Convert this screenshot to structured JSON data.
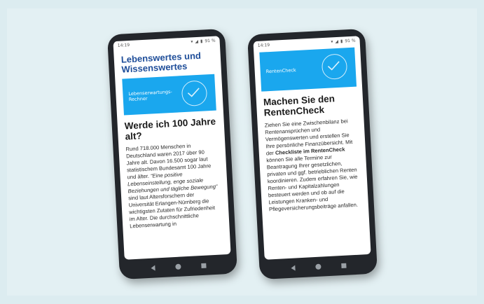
{
  "phone_left": {
    "status": {
      "time": "14:19",
      "battery": "91 %"
    },
    "section_heading": "Lebenswertes und Wissenswertes",
    "banner_label": "Lebenserwartungs-Rechner",
    "title": "Werde ich 100 Jahre alt?",
    "body_1": "Rund 718.000 Menschen in Deutschland waren 2017 über 90 Jahre alt. Davon 16.500 sogar laut statistischem Bundesamt 100 Jahre und älter.",
    "body_quote": "“Eine positive Lebenseinstellung, enge soziale Beziehungen und tägliche Bewegung”",
    "body_2": "sind laut Altersforschern der Universität Erlangen-Nürnberg die wichtigsten Zutaten für Zufriedenheit im Alter. Die durchschnittliche Lebenserwartung in"
  },
  "phone_right": {
    "status": {
      "time": "14:19",
      "battery": "91 %"
    },
    "banner_label": "RentenCheck",
    "title": "Machen Sie den RentenCheck",
    "body_1": "Ziehen Sie eine Zwischenbilanz bei Rentenansprüchen und Vermögenswerten und erstellen Sie Ihre persönliche Finanzübersicht. Mit der",
    "body_bold": "Checkliste im RentenCheck",
    "body_2": "können Sie alle Termine zur Beantragung Ihrer gesetzlichen, privaten und ggf. betrieblichen Renten koordinieren. Zudem erfahren Sie, wie Renten- und Kapitalzahlungen besteuert werden und ob auf die Leistungen Kranken- und Pflegeversicherungsbeiträge anfallen."
  },
  "icons": {
    "check": "check-circle-icon",
    "back": "back-icon",
    "home": "home-icon",
    "recent": "recent-apps-icon"
  },
  "colors": {
    "background": "#dcecf0",
    "banner": "#1aa7ee",
    "heading": "#1e4d99",
    "phone_frame": "#23262b"
  }
}
